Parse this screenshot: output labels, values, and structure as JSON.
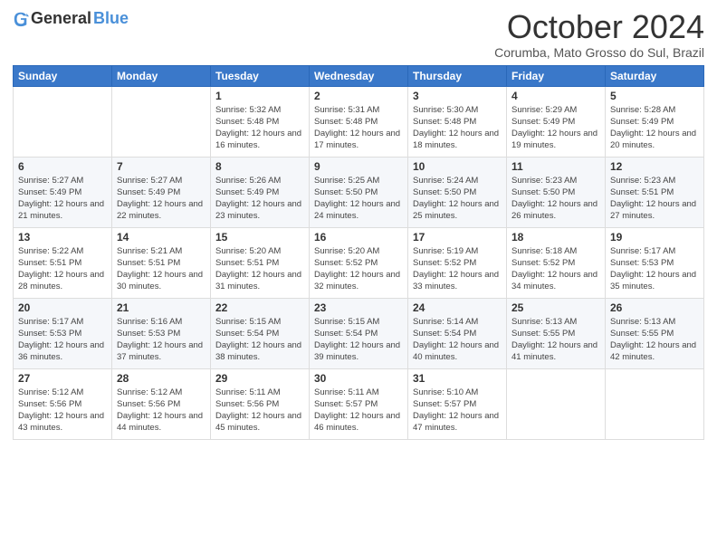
{
  "header": {
    "logo_general": "General",
    "logo_blue": "Blue",
    "month_title": "October 2024",
    "subtitle": "Corumba, Mato Grosso do Sul, Brazil"
  },
  "days_of_week": [
    "Sunday",
    "Monday",
    "Tuesday",
    "Wednesday",
    "Thursday",
    "Friday",
    "Saturday"
  ],
  "weeks": [
    [
      {
        "day": "",
        "info": ""
      },
      {
        "day": "",
        "info": ""
      },
      {
        "day": "1",
        "info": "Sunrise: 5:32 AM\nSunset: 5:48 PM\nDaylight: 12 hours and 16 minutes."
      },
      {
        "day": "2",
        "info": "Sunrise: 5:31 AM\nSunset: 5:48 PM\nDaylight: 12 hours and 17 minutes."
      },
      {
        "day": "3",
        "info": "Sunrise: 5:30 AM\nSunset: 5:48 PM\nDaylight: 12 hours and 18 minutes."
      },
      {
        "day": "4",
        "info": "Sunrise: 5:29 AM\nSunset: 5:49 PM\nDaylight: 12 hours and 19 minutes."
      },
      {
        "day": "5",
        "info": "Sunrise: 5:28 AM\nSunset: 5:49 PM\nDaylight: 12 hours and 20 minutes."
      }
    ],
    [
      {
        "day": "6",
        "info": "Sunrise: 5:27 AM\nSunset: 5:49 PM\nDaylight: 12 hours and 21 minutes."
      },
      {
        "day": "7",
        "info": "Sunrise: 5:27 AM\nSunset: 5:49 PM\nDaylight: 12 hours and 22 minutes."
      },
      {
        "day": "8",
        "info": "Sunrise: 5:26 AM\nSunset: 5:49 PM\nDaylight: 12 hours and 23 minutes."
      },
      {
        "day": "9",
        "info": "Sunrise: 5:25 AM\nSunset: 5:50 PM\nDaylight: 12 hours and 24 minutes."
      },
      {
        "day": "10",
        "info": "Sunrise: 5:24 AM\nSunset: 5:50 PM\nDaylight: 12 hours and 25 minutes."
      },
      {
        "day": "11",
        "info": "Sunrise: 5:23 AM\nSunset: 5:50 PM\nDaylight: 12 hours and 26 minutes."
      },
      {
        "day": "12",
        "info": "Sunrise: 5:23 AM\nSunset: 5:51 PM\nDaylight: 12 hours and 27 minutes."
      }
    ],
    [
      {
        "day": "13",
        "info": "Sunrise: 5:22 AM\nSunset: 5:51 PM\nDaylight: 12 hours and 28 minutes."
      },
      {
        "day": "14",
        "info": "Sunrise: 5:21 AM\nSunset: 5:51 PM\nDaylight: 12 hours and 30 minutes."
      },
      {
        "day": "15",
        "info": "Sunrise: 5:20 AM\nSunset: 5:51 PM\nDaylight: 12 hours and 31 minutes."
      },
      {
        "day": "16",
        "info": "Sunrise: 5:20 AM\nSunset: 5:52 PM\nDaylight: 12 hours and 32 minutes."
      },
      {
        "day": "17",
        "info": "Sunrise: 5:19 AM\nSunset: 5:52 PM\nDaylight: 12 hours and 33 minutes."
      },
      {
        "day": "18",
        "info": "Sunrise: 5:18 AM\nSunset: 5:52 PM\nDaylight: 12 hours and 34 minutes."
      },
      {
        "day": "19",
        "info": "Sunrise: 5:17 AM\nSunset: 5:53 PM\nDaylight: 12 hours and 35 minutes."
      }
    ],
    [
      {
        "day": "20",
        "info": "Sunrise: 5:17 AM\nSunset: 5:53 PM\nDaylight: 12 hours and 36 minutes."
      },
      {
        "day": "21",
        "info": "Sunrise: 5:16 AM\nSunset: 5:53 PM\nDaylight: 12 hours and 37 minutes."
      },
      {
        "day": "22",
        "info": "Sunrise: 5:15 AM\nSunset: 5:54 PM\nDaylight: 12 hours and 38 minutes."
      },
      {
        "day": "23",
        "info": "Sunrise: 5:15 AM\nSunset: 5:54 PM\nDaylight: 12 hours and 39 minutes."
      },
      {
        "day": "24",
        "info": "Sunrise: 5:14 AM\nSunset: 5:54 PM\nDaylight: 12 hours and 40 minutes."
      },
      {
        "day": "25",
        "info": "Sunrise: 5:13 AM\nSunset: 5:55 PM\nDaylight: 12 hours and 41 minutes."
      },
      {
        "day": "26",
        "info": "Sunrise: 5:13 AM\nSunset: 5:55 PM\nDaylight: 12 hours and 42 minutes."
      }
    ],
    [
      {
        "day": "27",
        "info": "Sunrise: 5:12 AM\nSunset: 5:56 PM\nDaylight: 12 hours and 43 minutes."
      },
      {
        "day": "28",
        "info": "Sunrise: 5:12 AM\nSunset: 5:56 PM\nDaylight: 12 hours and 44 minutes."
      },
      {
        "day": "29",
        "info": "Sunrise: 5:11 AM\nSunset: 5:56 PM\nDaylight: 12 hours and 45 minutes."
      },
      {
        "day": "30",
        "info": "Sunrise: 5:11 AM\nSunset: 5:57 PM\nDaylight: 12 hours and 46 minutes."
      },
      {
        "day": "31",
        "info": "Sunrise: 5:10 AM\nSunset: 5:57 PM\nDaylight: 12 hours and 47 minutes."
      },
      {
        "day": "",
        "info": ""
      },
      {
        "day": "",
        "info": ""
      }
    ]
  ]
}
